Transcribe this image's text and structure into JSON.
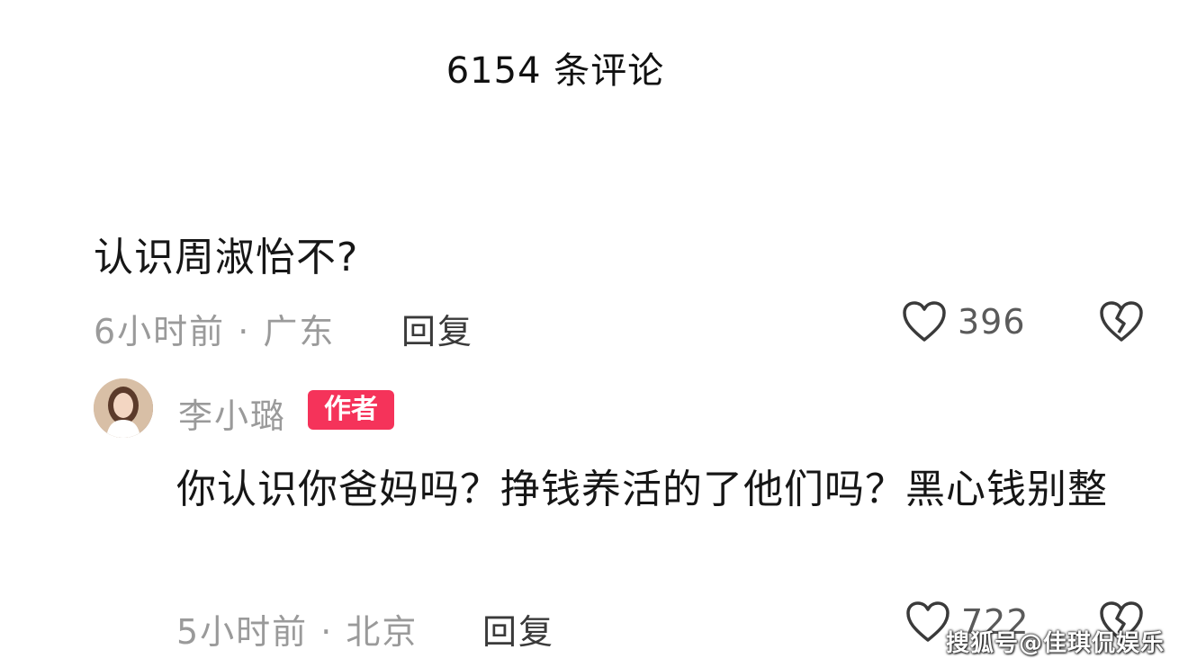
{
  "header": {
    "title": "6154 条评论"
  },
  "comment": {
    "text": "认识周淑怡不?",
    "meta": "6小时前 · 广东",
    "reply_label": "回复",
    "like_count": "396",
    "icons": {
      "like": "heart-outline-icon",
      "dislike": "broken-heart-icon"
    }
  },
  "reply": {
    "username": "李小璐",
    "badge": "作者",
    "text": "你认识你爸妈吗？挣钱养活的了他们吗？黑心钱别整",
    "meta": "5小时前 · 北京",
    "reply_label": "回复",
    "like_count": "722"
  },
  "watermark": "搜狐号@佳琪侃娱乐",
  "colors": {
    "badge": "#f5335a",
    "meta_text": "#9a9a9a",
    "body_text": "#161616",
    "background": "#ffffff"
  }
}
